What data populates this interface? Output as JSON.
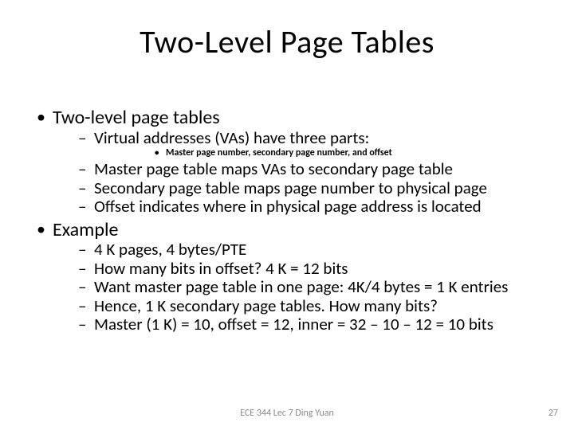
{
  "title": "Two-Level Page Tables",
  "bullets": {
    "b1": "Two-level page tables",
    "b1_1": "Virtual addresses (VAs) have three parts:",
    "b1_1_1": "Master page number, secondary page number, and offset",
    "b1_2": "Master page table maps VAs to secondary page table",
    "b1_3": "Secondary page table maps page number to physical page",
    "b1_4": "Offset indicates where in physical page address is located",
    "b2": "Example",
    "b2_1": "4 K pages, 4 bytes/PTE",
    "b2_2": "How many bits in offset? 4 K = 12 bits",
    "b2_3": "Want master page table in one page: 4K/4 bytes = 1 K entries",
    "b2_4": "Hence, 1 K secondary page tables.  How many bits?",
    "b2_5": "Master (1 K) = 10, offset = 12, inner = 32 – 10 – 12 = 10 bits"
  },
  "footer": {
    "center": "ECE 344 Lec 7 Ding Yuan",
    "page": "27"
  }
}
